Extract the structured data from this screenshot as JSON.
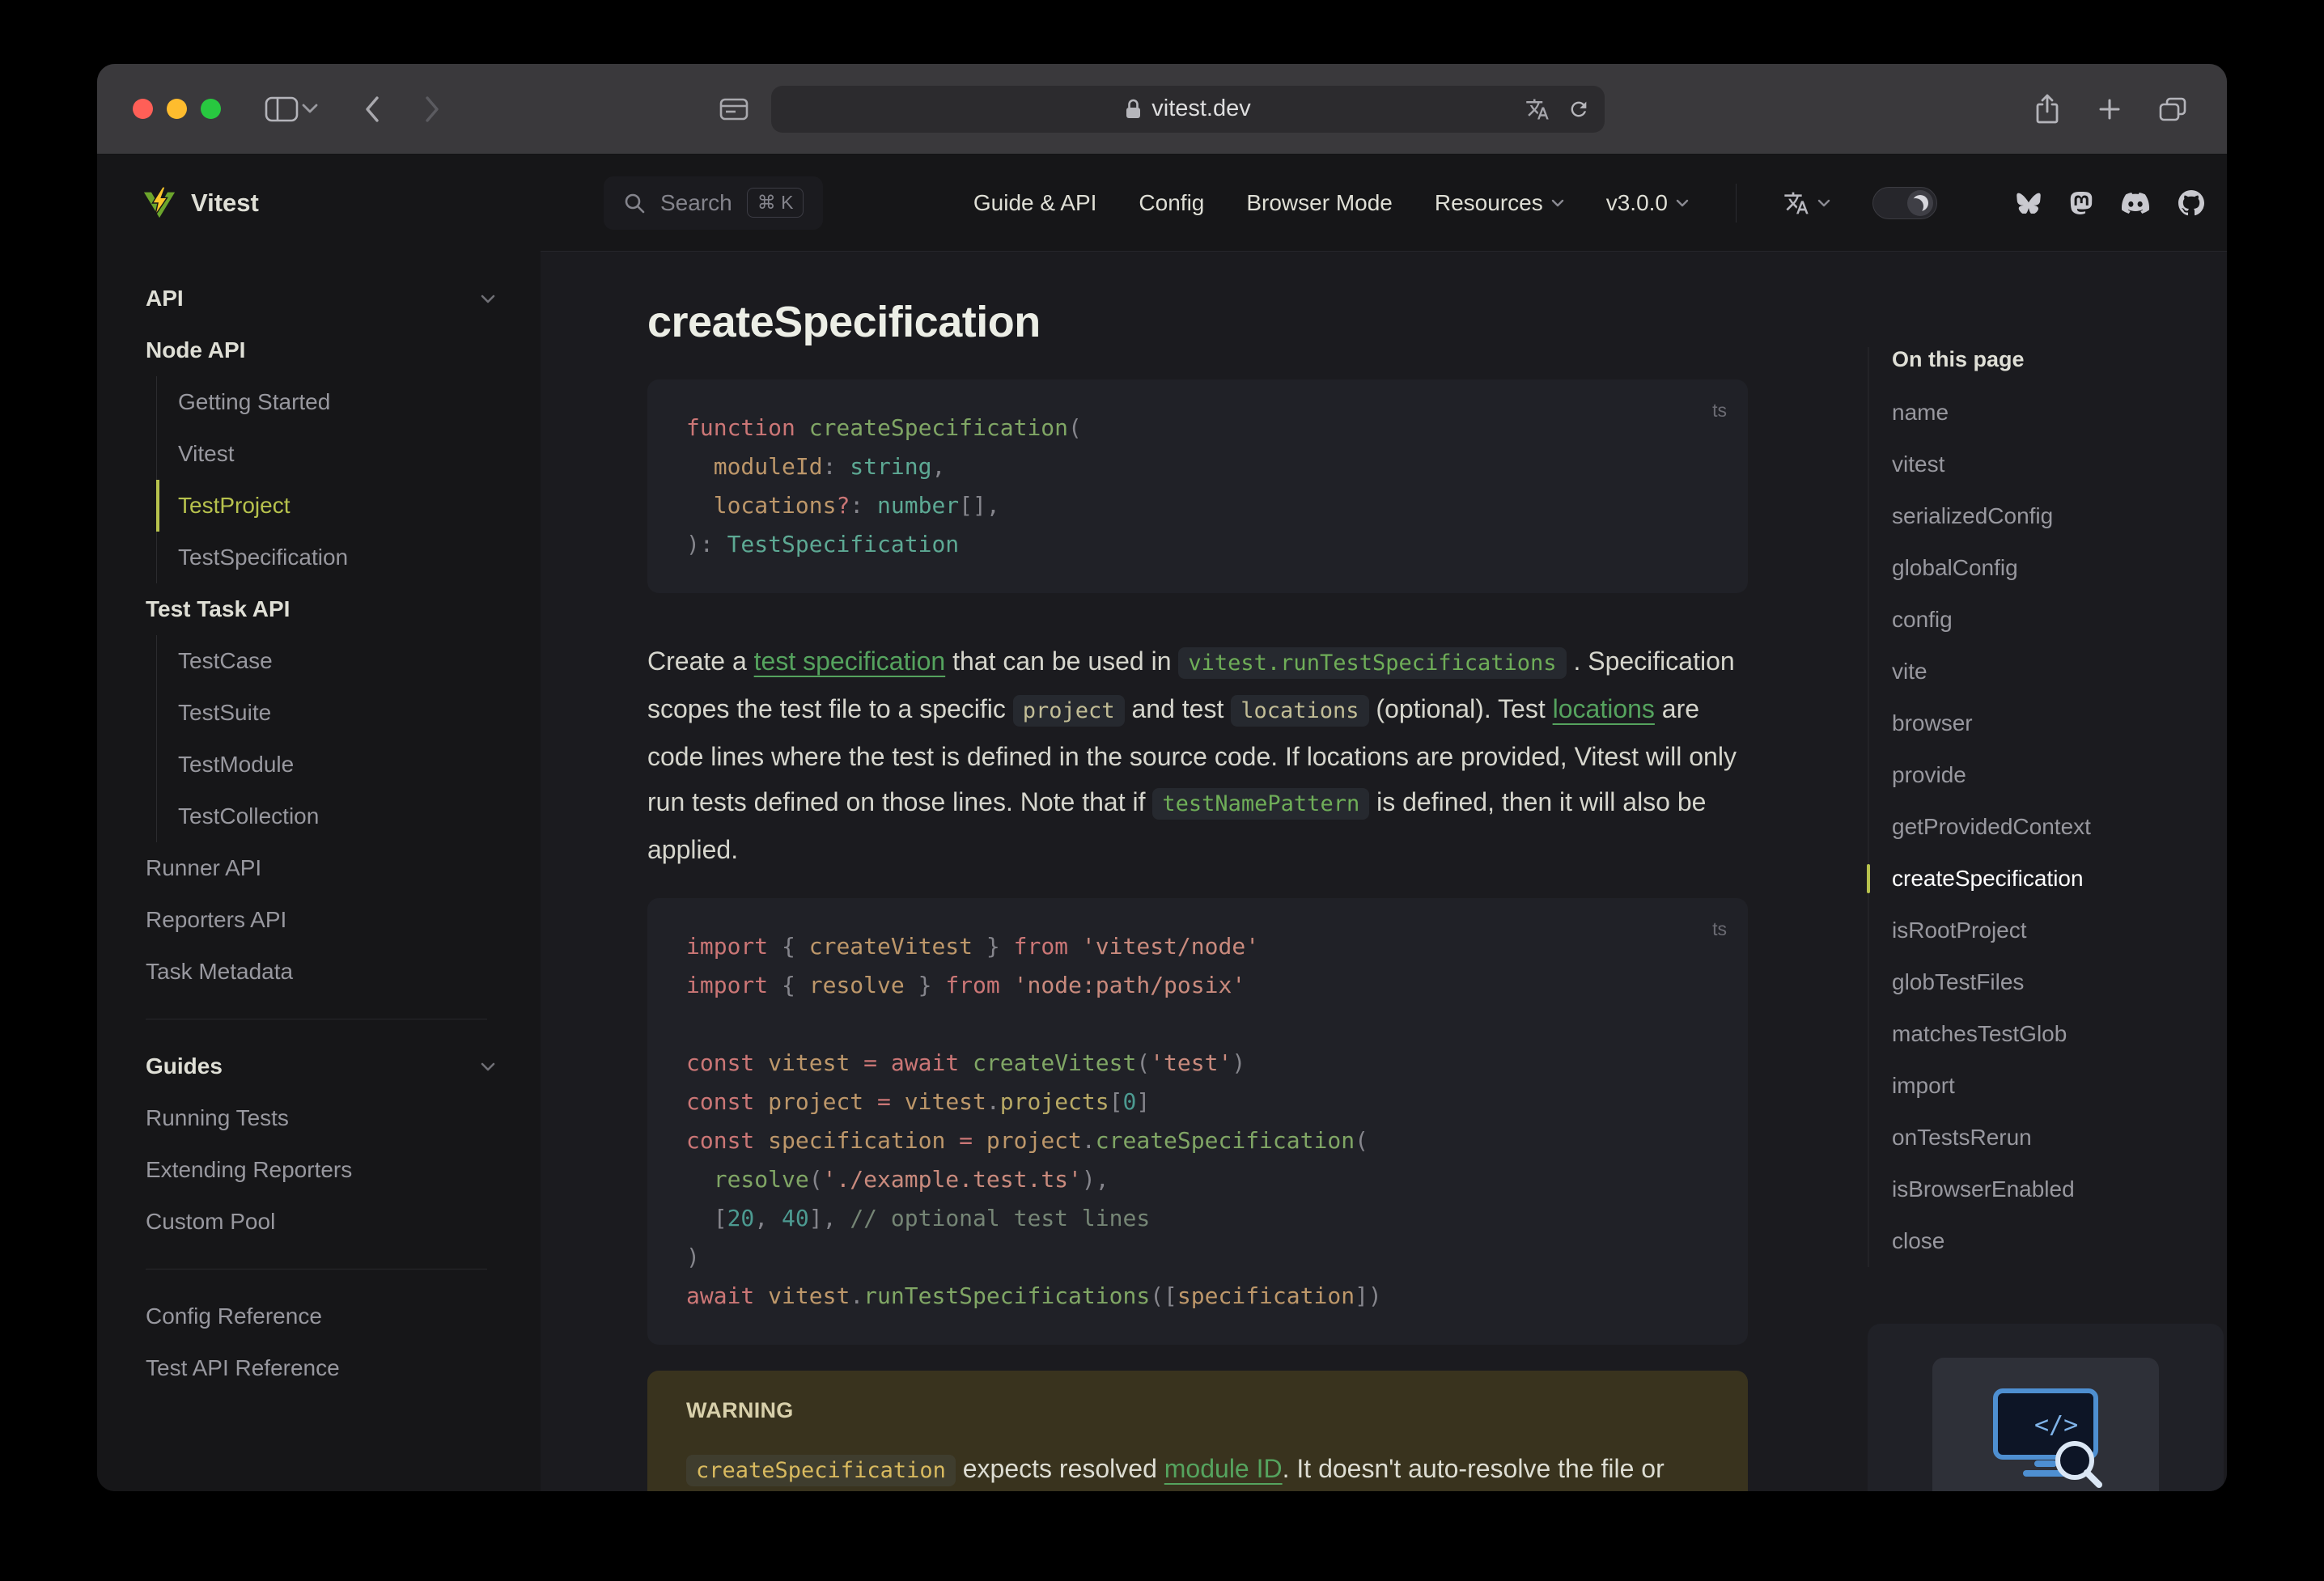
{
  "browser": {
    "url": "vitest.dev"
  },
  "colors": {
    "brand": "#b7c24d",
    "link": "#55a35e",
    "code_green": "#6fae58",
    "warning_bg": "#39331e"
  },
  "icons": {
    "toolbar": [
      "close",
      "minimize",
      "zoom",
      "sidebar-toggle",
      "chevron-down",
      "back",
      "forward",
      "page-settings",
      "lock",
      "translate",
      "reload",
      "share",
      "new-tab",
      "tab-overview"
    ],
    "nav": [
      "search",
      "chevron-down",
      "translate",
      "theme-toggle-moon",
      "bluesky",
      "mastodon",
      "discord",
      "github"
    ],
    "aside": [
      "monitor-code-magnifier"
    ]
  },
  "nav": {
    "search_label": "Search",
    "search_kbd": "⌘ K",
    "links": [
      "Guide & API",
      "Config",
      "Browser Mode",
      "Resources",
      "v3.0.0"
    ]
  },
  "sidebar": {
    "logo": "Vitest",
    "items": [
      {
        "label": "API"
      },
      {
        "label": "Node API"
      },
      {
        "label": "Getting Started"
      },
      {
        "label": "Vitest"
      },
      {
        "label": "TestProject"
      },
      {
        "label": "TestSpecification"
      },
      {
        "label": "Test Task API"
      },
      {
        "label": "TestCase"
      },
      {
        "label": "TestSuite"
      },
      {
        "label": "TestModule"
      },
      {
        "label": "TestCollection"
      },
      {
        "label": "Runner API"
      },
      {
        "label": "Reporters API"
      },
      {
        "label": "Task Metadata"
      },
      {
        "label": "Guides"
      },
      {
        "label": "Running Tests"
      },
      {
        "label": "Extending Reporters"
      },
      {
        "label": "Custom Pool"
      },
      {
        "label": "Config Reference"
      },
      {
        "label": "Test API Reference"
      }
    ],
    "active": "TestProject"
  },
  "doc": {
    "title": "createSpecification",
    "lang": "ts",
    "code1": [
      [
        {
          "t": "function ",
          "c": "k"
        },
        {
          "t": "createSpecification",
          "c": "f"
        },
        {
          "t": "(",
          "c": "p"
        }
      ],
      [
        {
          "t": "  "
        },
        {
          "t": "moduleId",
          "c": "v"
        },
        {
          "t": ":",
          "c": "p"
        },
        {
          "t": " "
        },
        {
          "t": "string",
          "c": "ty"
        },
        {
          "t": ",",
          "c": "p"
        }
      ],
      [
        {
          "t": "  "
        },
        {
          "t": "locations",
          "c": "v"
        },
        {
          "t": "?",
          "c": "k"
        },
        {
          "t": ": ",
          "c": "p"
        },
        {
          "t": "number",
          "c": "ty"
        },
        {
          "t": "[],",
          "c": "p"
        }
      ],
      [
        {
          "t": "): ",
          "c": "p"
        },
        {
          "t": "TestSpecification",
          "c": "ty"
        }
      ]
    ],
    "paragraph": [
      {
        "t": "Create a "
      },
      {
        "t": "test specification",
        "c": "link"
      },
      {
        "t": " that can be used in "
      },
      {
        "t": "vitest.runTestSpecifications",
        "c": "icode green"
      },
      {
        "t": " . Specification scopes the test file to a specific "
      },
      {
        "t": "project",
        "c": "icode"
      },
      {
        "t": " and test "
      },
      {
        "t": "locations",
        "c": "icode"
      },
      {
        "t": " (optional). Test "
      },
      {
        "t": "locations",
        "c": "link"
      },
      {
        "t": " are code lines where the test is defined in the source code. If locations are provided, Vitest will only run tests defined on those lines. Note that if "
      },
      {
        "t": "testNamePattern",
        "c": "icode green"
      },
      {
        "t": " is defined, then it will also be applied."
      }
    ],
    "code2": [
      [
        {
          "t": "import",
          "c": "k"
        },
        {
          "t": " { ",
          "c": "p"
        },
        {
          "t": "createVitest",
          "c": "v"
        },
        {
          "t": " } ",
          "c": "p"
        },
        {
          "t": "from",
          "c": "k"
        },
        {
          "t": " "
        },
        {
          "t": "'vitest/node'",
          "c": "s"
        }
      ],
      [
        {
          "t": "import",
          "c": "k"
        },
        {
          "t": " { ",
          "c": "p"
        },
        {
          "t": "resolve",
          "c": "v"
        },
        {
          "t": " } ",
          "c": "p"
        },
        {
          "t": "from",
          "c": "k"
        },
        {
          "t": " "
        },
        {
          "t": "'node:path/posix'",
          "c": "s"
        }
      ],
      [],
      [
        {
          "t": "const",
          "c": "k"
        },
        {
          "t": " "
        },
        {
          "t": "vitest",
          "c": "v"
        },
        {
          "t": " "
        },
        {
          "t": "=",
          "c": "k"
        },
        {
          "t": " "
        },
        {
          "t": "await",
          "c": "k"
        },
        {
          "t": " "
        },
        {
          "t": "createVitest",
          "c": "f"
        },
        {
          "t": "(",
          "c": "p"
        },
        {
          "t": "'test'",
          "c": "s"
        },
        {
          "t": ")",
          "c": "p"
        }
      ],
      [
        {
          "t": "const",
          "c": "k"
        },
        {
          "t": " "
        },
        {
          "t": "project",
          "c": "v"
        },
        {
          "t": " "
        },
        {
          "t": "=",
          "c": "k"
        },
        {
          "t": " "
        },
        {
          "t": "vitest",
          "c": "v"
        },
        {
          "t": ".",
          "c": "p"
        },
        {
          "t": "projects",
          "c": "pr"
        },
        {
          "t": "[",
          "c": "p"
        },
        {
          "t": "0",
          "c": "n"
        },
        {
          "t": "]",
          "c": "p"
        }
      ],
      [
        {
          "t": "const",
          "c": "k"
        },
        {
          "t": " "
        },
        {
          "t": "specification",
          "c": "v"
        },
        {
          "t": " "
        },
        {
          "t": "=",
          "c": "k"
        },
        {
          "t": " "
        },
        {
          "t": "project",
          "c": "v"
        },
        {
          "t": ".",
          "c": "p"
        },
        {
          "t": "createSpecification",
          "c": "f"
        },
        {
          "t": "(",
          "c": "p"
        }
      ],
      [
        {
          "t": "  "
        },
        {
          "t": "resolve",
          "c": "f"
        },
        {
          "t": "(",
          "c": "p"
        },
        {
          "t": "'./example.test.ts'",
          "c": "s"
        },
        {
          "t": "),",
          "c": "p"
        }
      ],
      [
        {
          "t": "  "
        },
        {
          "t": "[",
          "c": "p"
        },
        {
          "t": "20",
          "c": "n"
        },
        {
          "t": ", ",
          "c": "p"
        },
        {
          "t": "40",
          "c": "n"
        },
        {
          "t": "],",
          "c": "p"
        },
        {
          "t": " "
        },
        {
          "t": "// optional test lines",
          "c": "c"
        }
      ],
      [
        {
          "t": ")",
          "c": "p"
        }
      ],
      [
        {
          "t": "await",
          "c": "k"
        },
        {
          "t": " "
        },
        {
          "t": "vitest",
          "c": "v"
        },
        {
          "t": ".",
          "c": "p"
        },
        {
          "t": "runTestSpecifications",
          "c": "f"
        },
        {
          "t": "(",
          "c": "p"
        },
        {
          "t": "[",
          "c": "p"
        },
        {
          "t": "specification",
          "c": "v"
        },
        {
          "t": "])",
          "c": "p"
        }
      ]
    ],
    "warning_title": "WARNING",
    "warning_body": [
      {
        "t": "createSpecification",
        "c": "icode yellow"
      },
      {
        "t": " expects resolved "
      },
      {
        "t": "module ID",
        "c": "link"
      },
      {
        "t": ". It doesn't auto-resolve the file or check that it exists on the file system."
      }
    ]
  },
  "toc": {
    "title": "On this page",
    "items": [
      "name",
      "vitest",
      "serializedConfig",
      "globalConfig",
      "config",
      "vite",
      "browser",
      "provide",
      "getProvidedContext",
      "createSpecification",
      "isRootProject",
      "globTestFiles",
      "matchesTestGlob",
      "import",
      "onTestsRerun",
      "isBrowserEnabled",
      "close"
    ],
    "active": "createSpecification"
  }
}
